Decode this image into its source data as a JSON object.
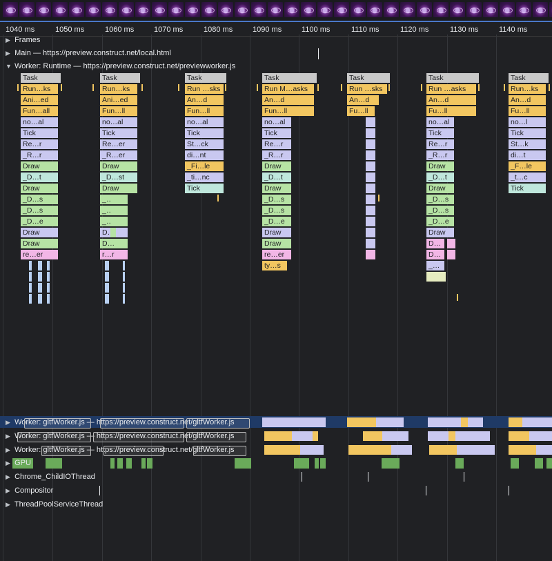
{
  "ruler": {
    "labels": [
      "1040 ms",
      "1050 ms",
      "1060 ms",
      "1070 ms",
      "1080 ms",
      "1090 ms",
      "1100 ms",
      "1110 ms",
      "1120 ms",
      "1130 ms",
      "1140 ms"
    ]
  },
  "tracks": {
    "frames": "Frames",
    "main": "Main — https://preview.construct.net/local.html",
    "worker_runtime": "Worker: Runtime — https://preview.construct.net/previewworker.js",
    "gltf_worker_1": "Worker: gltfWorker.js — https://preview.construct.net/gltfWorker.js",
    "gltf_worker_2": "Worker: gltfWorker.js — https://preview.construct.net/gltfWorker.js",
    "gltf_worker_3": "Worker: gltfWorker.js — https://preview.construct.net/gltfWorker.js",
    "gpu": "GPU",
    "child_io": "Chrome_ChildIOThread",
    "compositor": "Compositor",
    "threadpool": "ThreadPoolServiceThread"
  },
  "icons": {
    "collapsed": "triangle-right-icon",
    "expanded": "triangle-down-icon"
  },
  "colors": {
    "task": "#c9c9c9",
    "scripting": "#f2c660",
    "rendering": "#c9c8f0",
    "painting": "#b6e3a4",
    "gpu": "#6aaa5a",
    "selection": "#1f3a66"
  },
  "flame": {
    "col1": [
      "Task",
      "Run…ks",
      "Ani…ed",
      "Fun…all",
      "no…al",
      "Tick",
      "Re…r",
      "_R…r",
      "Draw",
      "_D…t",
      "Draw",
      "_D…s",
      "_D…s",
      "_D…e",
      "Draw",
      "Draw",
      "re…er"
    ],
    "col2": [
      "Task",
      "Run…ks",
      "Ani…ed",
      "Fun…ll",
      "no…al",
      "Tick",
      "Re…er",
      "_R…er",
      "Draw",
      "_D…st",
      "Draw",
      "_…",
      "_…",
      "_…",
      "D…",
      "D…",
      "r…r"
    ],
    "col3": [
      "Task",
      "Run …sks",
      "An…d",
      "Fun…ll",
      "no…al",
      "Tick",
      "St…ck",
      "di…nt",
      "_Fi…le",
      "_ti…nc",
      "Tick"
    ],
    "col4": [
      "Task",
      "Run M…asks",
      "An…d",
      "Fun…ll",
      "no…al",
      "Tick",
      "Re…r",
      "_R…r",
      "Draw",
      "_D…t",
      "Draw",
      "_D…s",
      "_D…s",
      "_D…e",
      "Draw",
      "Draw",
      "re…er",
      "ty…s"
    ],
    "col5": [
      "Task",
      "Run …sks",
      "An…d",
      "Fu…ll"
    ],
    "col6": [
      "Task",
      "Run …asks",
      "An…d",
      "Fu…ll",
      "no…al",
      "Tick",
      "Re…r",
      "_R…r",
      "Draw",
      "_D…t",
      "Draw",
      "_D…s",
      "_D…s",
      "_D…e",
      "Draw",
      "D…",
      "D…",
      "_…",
      "_…"
    ],
    "col7": [
      "Task",
      "Run…ks",
      "An…d",
      "Fu…ll",
      "no…l",
      "Tick",
      "St…k",
      "di…t",
      "_F…le",
      "_t…c",
      "Tick"
    ]
  }
}
